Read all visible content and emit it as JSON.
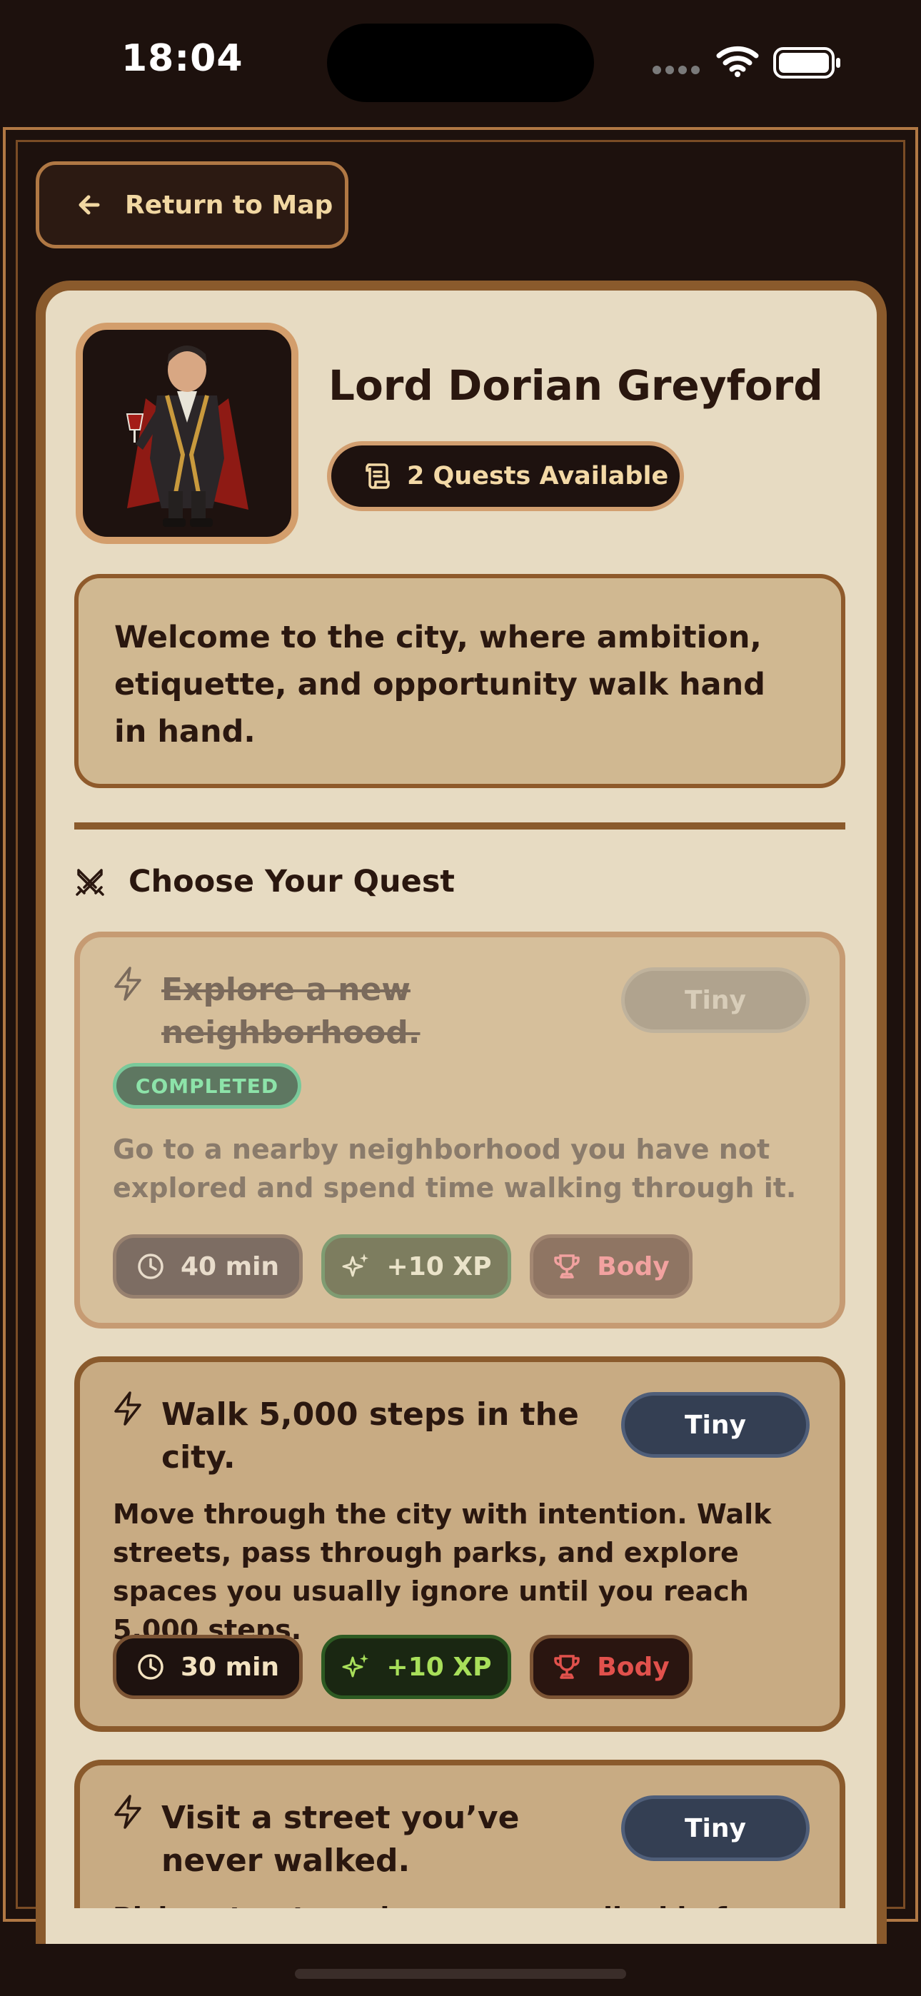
{
  "status_bar": {
    "time": "18:04"
  },
  "nav": {
    "back_label": "Return to Map"
  },
  "npc": {
    "name": "Lord Dorian Greyford",
    "quests_available": "2 Quests Available",
    "greeting": "Welcome to the city, where ambition, etiquette, and opportunity walk hand in hand."
  },
  "section": {
    "title": "Choose Your Quest"
  },
  "quests": [
    {
      "title": "Explore a new neighborhood.",
      "difficulty": "Tiny",
      "status": "COMPLETED",
      "description": "Go to a nearby neighborhood you have not explored and spend time walking through it.",
      "duration": "40 min",
      "xp": "+10 XP",
      "category": "Body"
    },
    {
      "title": "Walk 5,000 steps in the city.",
      "difficulty": "Tiny",
      "description": "Move through the city with intention. Walk streets, pass through parks, and explore spaces you usually ignore until you reach 5,000 steps.",
      "duration": "30 min",
      "xp": "+10 XP",
      "category": "Body"
    },
    {
      "title": "Visit a street you’ve never walked.",
      "difficulty": "Tiny",
      "description": "Pick a street you have never walked before and explore it."
    }
  ],
  "colors": {
    "background": "#1d110d",
    "panel": "#e7dbc2",
    "frame": "#8a5a2c",
    "xp_green": "#a8df5a",
    "category_red": "#e1514c",
    "completed_green": "#8de3a9"
  }
}
